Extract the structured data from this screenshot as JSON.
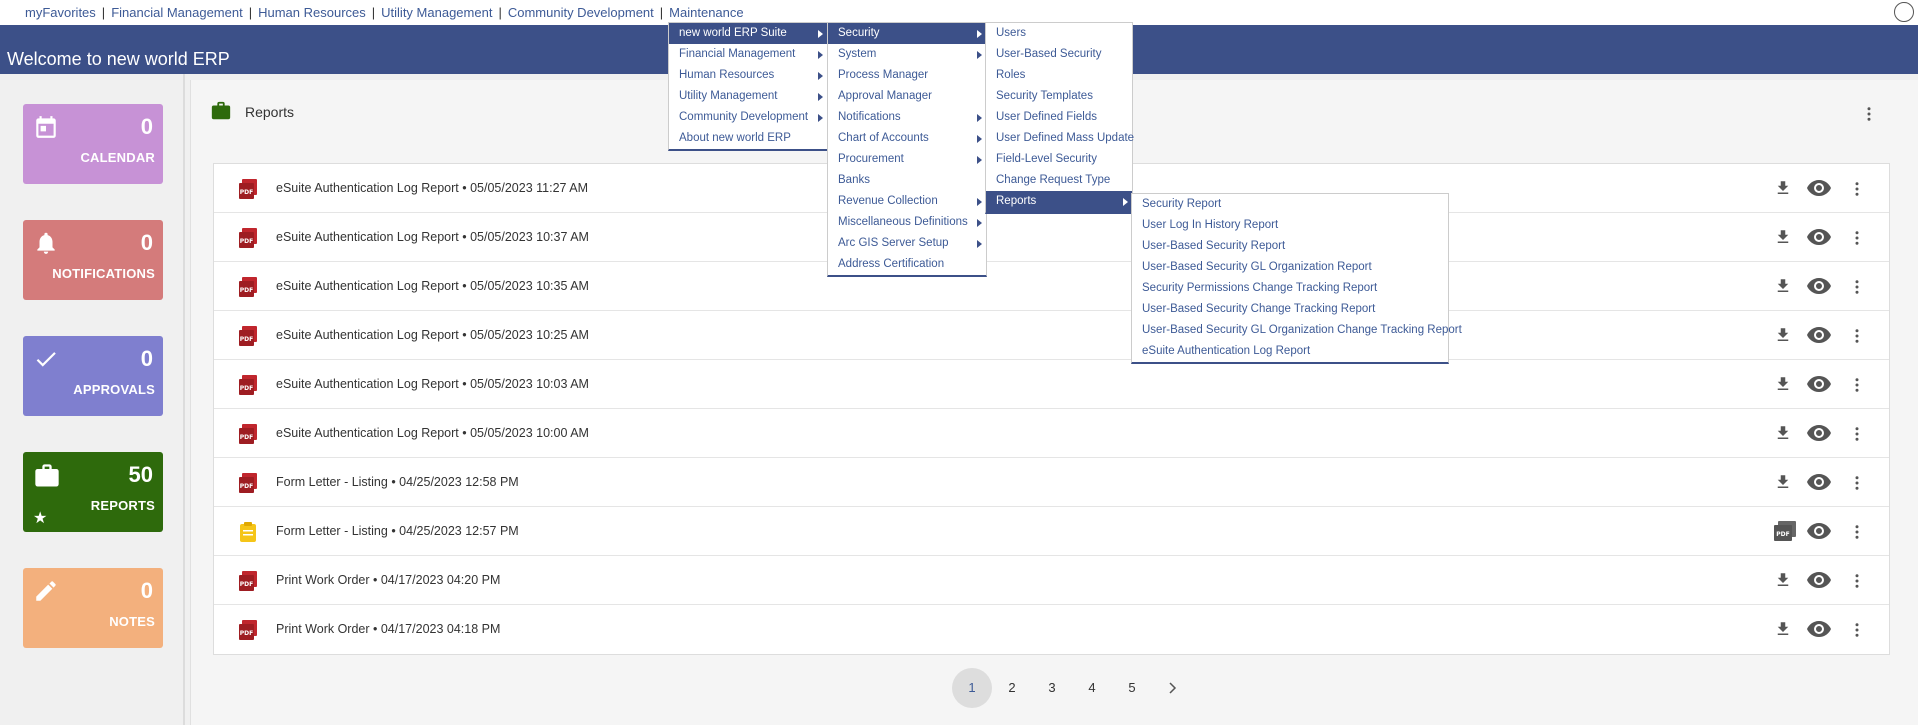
{
  "topnav": {
    "links": [
      "myFavorites",
      "Financial Management",
      "Human Resources",
      "Utility Management",
      "Community Development",
      "Maintenance"
    ]
  },
  "header": {
    "title": "Welcome to new world ERP"
  },
  "tiles": [
    {
      "name": "calendar",
      "count": "0",
      "label": "CALENDAR",
      "color": "#c792d6",
      "icon": "calendar-icon"
    },
    {
      "name": "notifications",
      "count": "0",
      "label": "NOTIFICATIONS",
      "color": "#d47b7b",
      "icon": "bell-icon"
    },
    {
      "name": "approvals",
      "count": "0",
      "label": "APPROVALS",
      "color": "#7f7fcf",
      "icon": "check-icon"
    },
    {
      "name": "reports",
      "count": "50",
      "label": "REPORTS",
      "color": "#2e6a0c",
      "icon": "briefcase-icon"
    },
    {
      "name": "notes",
      "count": "0",
      "label": "NOTES",
      "color": "#f3b07d",
      "icon": "pencil-icon"
    }
  ],
  "reports": {
    "title": "Reports",
    "rows": [
      {
        "text": "eSuite Authentication Log Report • 05/05/2023 11:27 AM",
        "type": "pdf",
        "action": "download"
      },
      {
        "text": "eSuite Authentication Log Report • 05/05/2023 10:37 AM",
        "type": "pdf",
        "action": "download"
      },
      {
        "text": "eSuite Authentication Log Report • 05/05/2023 10:35 AM",
        "type": "pdf",
        "action": "download"
      },
      {
        "text": "eSuite Authentication Log Report • 05/05/2023 10:25 AM",
        "type": "pdf",
        "action": "download"
      },
      {
        "text": "eSuite Authentication Log Report • 05/05/2023 10:03 AM",
        "type": "pdf",
        "action": "download"
      },
      {
        "text": "eSuite Authentication Log Report • 05/05/2023 10:00 AM",
        "type": "pdf",
        "action": "download"
      },
      {
        "text": "Form Letter - Listing • 04/25/2023 12:58 PM",
        "type": "pdf",
        "action": "download"
      },
      {
        "text": "Form Letter - Listing • 04/25/2023 12:57 PM",
        "type": "note",
        "action": "pdf"
      },
      {
        "text": "Print Work Order • 04/17/2023 04:20 PM",
        "type": "pdf",
        "action": "download"
      },
      {
        "text": "Print Work Order • 04/17/2023 04:18 PM",
        "type": "pdf",
        "action": "download"
      }
    ]
  },
  "pagination": {
    "pages": [
      "1",
      "2",
      "3",
      "4",
      "5"
    ],
    "active": "1"
  },
  "menus": {
    "suite": {
      "items": [
        {
          "label": "new world ERP Suite",
          "sub": true,
          "selected": true
        },
        {
          "label": "Financial Management",
          "sub": true
        },
        {
          "label": "Human Resources",
          "sub": true
        },
        {
          "label": "Utility Management",
          "sub": true
        },
        {
          "label": "Community Development",
          "sub": true
        },
        {
          "label": "About new world ERP",
          "sub": false
        }
      ]
    },
    "suite_sub": {
      "items": [
        {
          "label": "Security",
          "sub": true,
          "selected": true
        },
        {
          "label": "System",
          "sub": true
        },
        {
          "label": "Process Manager",
          "sub": false
        },
        {
          "label": "Approval Manager",
          "sub": false
        },
        {
          "label": "Notifications",
          "sub": true
        },
        {
          "label": "Chart of Accounts",
          "sub": true
        },
        {
          "label": "Procurement",
          "sub": true
        },
        {
          "label": "Banks",
          "sub": false
        },
        {
          "label": "Revenue Collection",
          "sub": true
        },
        {
          "label": "Miscellaneous Definitions",
          "sub": true
        },
        {
          "label": "Arc GIS Server Setup",
          "sub": true
        },
        {
          "label": "Address Certification",
          "sub": false
        }
      ]
    },
    "security": {
      "items": [
        {
          "label": "Users",
          "sub": false
        },
        {
          "label": "User-Based Security",
          "sub": false
        },
        {
          "label": "Roles",
          "sub": false
        },
        {
          "label": "Security Templates",
          "sub": false
        },
        {
          "label": "User Defined Fields",
          "sub": false
        },
        {
          "label": "User Defined Mass Update",
          "sub": false
        },
        {
          "label": "Field-Level Security",
          "sub": false
        },
        {
          "label": "Change Request Type",
          "sub": false
        },
        {
          "label": "Reports",
          "sub": true,
          "selected": true
        }
      ]
    },
    "security_reports": {
      "items": [
        {
          "label": "Security Report",
          "sub": false
        },
        {
          "label": "User Log In History Report",
          "sub": false
        },
        {
          "label": "User-Based Security Report",
          "sub": false
        },
        {
          "label": "User-Based Security GL Organization Report",
          "sub": false
        },
        {
          "label": "Security Permissions Change Tracking Report",
          "sub": false
        },
        {
          "label": "User-Based Security Change Tracking Report",
          "sub": false
        },
        {
          "label": "User-Based Security GL Organization Change Tracking Report",
          "sub": false
        },
        {
          "label": "eSuite Authentication Log Report",
          "sub": false
        }
      ]
    }
  }
}
